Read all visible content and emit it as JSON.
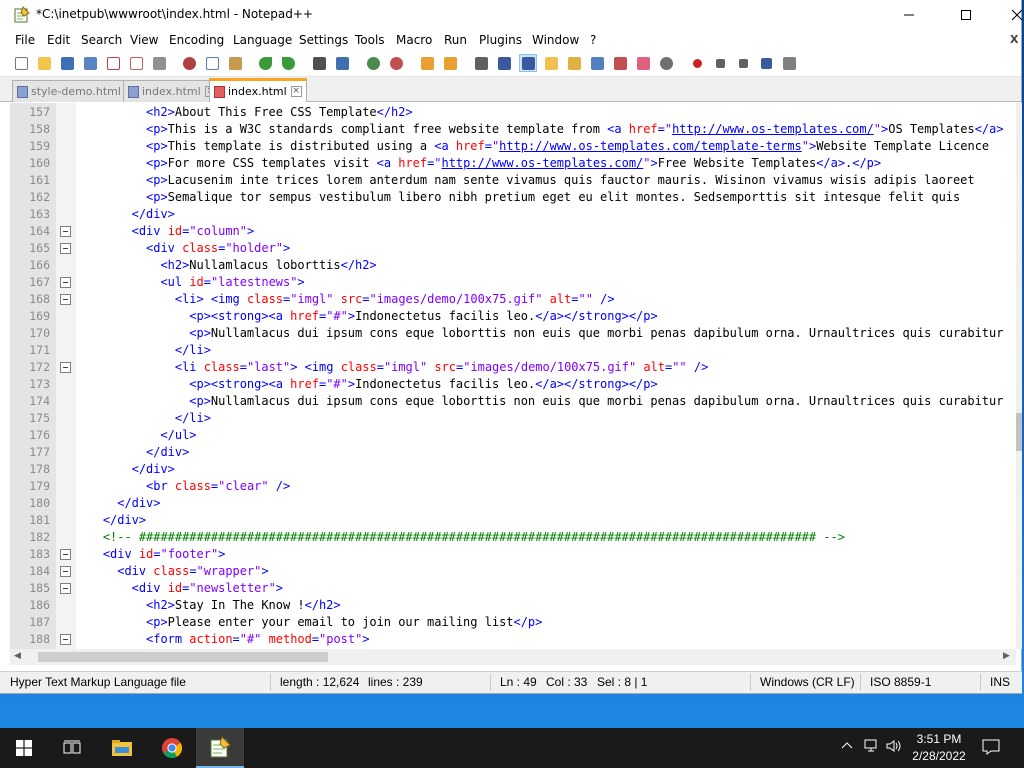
{
  "window": {
    "title": "*C:\\inetpub\\wwwroot\\index.html - Notepad++"
  },
  "menu": [
    "File",
    "Edit",
    "Search",
    "View",
    "Encoding",
    "Language",
    "Settings",
    "Tools",
    "Macro",
    "Run",
    "Plugins",
    "Window",
    "?"
  ],
  "menu_close_glyph": "X",
  "tabs": [
    {
      "label": "style-demo.html",
      "active": false
    },
    {
      "label": "index.html",
      "active": false
    },
    {
      "label": "index.html",
      "active": true
    }
  ],
  "editor": {
    "lines": [
      {
        "n": 157,
        "html": "          <span class=tag>&lt;h2&gt;</span>About This Free CSS Template<span class=tag>&lt;/h2&gt;</span>"
      },
      {
        "n": 158,
        "html": "          <span class=tag>&lt;p&gt;</span>This is a W3C standards compliant free website template from <span class=tag>&lt;a</span> <span class=attr>href</span><span class=tag>=</span><span class=val>\"<span class=url>http://www.os-templates.com/</span>\"</span><span class=tag>&gt;</span>OS Templates<span class=tag>&lt;/a&gt;</span>"
      },
      {
        "n": 159,
        "html": "          <span class=tag>&lt;p&gt;</span>This template is distributed using a <span class=tag>&lt;a</span> <span class=attr>href</span><span class=tag>=</span><span class=val>\"<span class=url>http://www.os-templates.com/template-terms</span>\"</span><span class=tag>&gt;</span>Website Template Licence"
      },
      {
        "n": 160,
        "html": "          <span class=tag>&lt;p&gt;</span>For more CSS templates visit <span class=tag>&lt;a</span> <span class=attr>href</span><span class=tag>=</span><span class=val>\"<span class=url>http://www.os-templates.com/</span>\"</span><span class=tag>&gt;</span>Free Website Templates<span class=tag>&lt;/a&gt;</span>.<span class=tag>&lt;/p&gt;</span>"
      },
      {
        "n": 161,
        "html": "          <span class=tag>&lt;p&gt;</span>Lacusenim inte trices lorem anterdum nam sente vivamus quis fauctor mauris. Wisinon vivamus wisis adipis laoreet"
      },
      {
        "n": 162,
        "html": "          <span class=tag>&lt;p&gt;</span>Semalique tor sempus vestibulum libero nibh pretium eget eu elit montes. Sedsemporttis sit intesque felit quis"
      },
      {
        "n": 163,
        "html": "        <span class=tag>&lt;/div&gt;</span>"
      },
      {
        "n": 164,
        "fold": true,
        "html": "        <span class=tag>&lt;div</span> <span class=attr>id</span><span class=tag>=</span><span class=val>\"column\"</span><span class=tag>&gt;</span>"
      },
      {
        "n": 165,
        "fold": true,
        "html": "          <span class=tag>&lt;div</span> <span class=attr>class</span><span class=tag>=</span><span class=val>\"holder\"</span><span class=tag>&gt;</span>"
      },
      {
        "n": 166,
        "html": "            <span class=tag>&lt;h2&gt;</span>Nullamlacus loborttis<span class=tag>&lt;/h2&gt;</span>"
      },
      {
        "n": 167,
        "fold": true,
        "html": "            <span class=tag>&lt;ul</span> <span class=attr>id</span><span class=tag>=</span><span class=val>\"latestnews\"</span><span class=tag>&gt;</span>"
      },
      {
        "n": 168,
        "fold": true,
        "html": "              <span class=tag>&lt;li&gt;</span> <span class=tag>&lt;img</span> <span class=attr>class</span><span class=tag>=</span><span class=val>\"imgl\"</span> <span class=attr>src</span><span class=tag>=</span><span class=val>\"images/demo/100x75.gif\"</span> <span class=attr>alt</span><span class=tag>=</span><span class=val>\"\"</span> <span class=tag>/&gt;</span>"
      },
      {
        "n": 169,
        "html": "                <span class=tag>&lt;p&gt;&lt;strong&gt;&lt;a</span> <span class=attr>href</span><span class=tag>=</span><span class=val>\"#\"</span><span class=tag>&gt;</span>Indonectetus facilis leo.<span class=tag>&lt;/a&gt;&lt;/strong&gt;&lt;/p&gt;</span>"
      },
      {
        "n": 170,
        "html": "                <span class=tag>&lt;p&gt;</span>Nullamlacus dui ipsum cons eque loborttis non euis que morbi penas dapibulum orna. Urnaultrices quis curabitur"
      },
      {
        "n": 171,
        "html": "              <span class=tag>&lt;/li&gt;</span>"
      },
      {
        "n": 172,
        "fold": true,
        "html": "              <span class=tag>&lt;li</span> <span class=attr>class</span><span class=tag>=</span><span class=val>\"last\"</span><span class=tag>&gt;</span> <span class=tag>&lt;img</span> <span class=attr>class</span><span class=tag>=</span><span class=val>\"imgl\"</span> <span class=attr>src</span><span class=tag>=</span><span class=val>\"images/demo/100x75.gif\"</span> <span class=attr>alt</span><span class=tag>=</span><span class=val>\"\"</span> <span class=tag>/&gt;</span>"
      },
      {
        "n": 173,
        "html": "                <span class=tag>&lt;p&gt;&lt;strong&gt;&lt;a</span> <span class=attr>href</span><span class=tag>=</span><span class=val>\"#\"</span><span class=tag>&gt;</span>Indonectetus facilis leo.<span class=tag>&lt;/a&gt;&lt;/strong&gt;&lt;/p&gt;</span>"
      },
      {
        "n": 174,
        "html": "                <span class=tag>&lt;p&gt;</span>Nullamlacus dui ipsum cons eque loborttis non euis que morbi penas dapibulum orna. Urnaultrices quis curabitur"
      },
      {
        "n": 175,
        "html": "              <span class=tag>&lt;/li&gt;</span>"
      },
      {
        "n": 176,
        "html": "            <span class=tag>&lt;/ul&gt;</span>"
      },
      {
        "n": 177,
        "html": "          <span class=tag>&lt;/div&gt;</span>"
      },
      {
        "n": 178,
        "html": "        <span class=tag>&lt;/div&gt;</span>"
      },
      {
        "n": 179,
        "html": "          <span class=tag>&lt;br</span> <span class=attr>class</span><span class=tag>=</span><span class=val>\"clear\"</span> <span class=tag>/&gt;</span>"
      },
      {
        "n": 180,
        "html": "      <span class=tag>&lt;/div&gt;</span>"
      },
      {
        "n": 181,
        "html": "    <span class=tag>&lt;/div&gt;</span>"
      },
      {
        "n": 182,
        "html": "    <span class=cmt>&lt;!-- ############################################################################################## --&gt;</span>"
      },
      {
        "n": 183,
        "fold": true,
        "html": "    <span class=tag>&lt;div</span> <span class=attr>id</span><span class=tag>=</span><span class=val>\"footer\"</span><span class=tag>&gt;</span>"
      },
      {
        "n": 184,
        "fold": true,
        "html": "      <span class=tag>&lt;div</span> <span class=attr>class</span><span class=tag>=</span><span class=val>\"wrapper\"</span><span class=tag>&gt;</span>"
      },
      {
        "n": 185,
        "fold": true,
        "html": "        <span class=tag>&lt;div</span> <span class=attr>id</span><span class=tag>=</span><span class=val>\"newsletter\"</span><span class=tag>&gt;</span>"
      },
      {
        "n": 186,
        "html": "          <span class=tag>&lt;h2&gt;</span>Stay In The Know !<span class=tag>&lt;/h2&gt;</span>"
      },
      {
        "n": 187,
        "html": "          <span class=tag>&lt;p&gt;</span>Please enter your email to join our mailing list<span class=tag>&lt;/p&gt;</span>"
      },
      {
        "n": 188,
        "fold": true,
        "html": "          <span class=tag>&lt;form</span> <span class=attr>action</span><span class=tag>=</span><span class=val>\"#\"</span> <span class=attr>method</span><span class=tag>=</span><span class=val>\"post\"</span><span class=tag>&gt;</span>"
      }
    ]
  },
  "status": {
    "filetype": "Hyper Text Markup Language file",
    "length": "length : 12,624",
    "lines": "lines : 239",
    "ln": "Ln : 49",
    "col": "Col : 33",
    "sel": "Sel : 8 | 1",
    "eol": "Windows (CR LF)",
    "encoding": "ISO 8859-1",
    "mode": "INS"
  },
  "taskbar": {
    "time": "3:51 PM",
    "date": "2/28/2022"
  },
  "colors": {
    "tag": "#0000ff",
    "attr": "#ff0000",
    "value": "#8000ff",
    "comment": "#008000",
    "active_tab": "#f6a623"
  }
}
